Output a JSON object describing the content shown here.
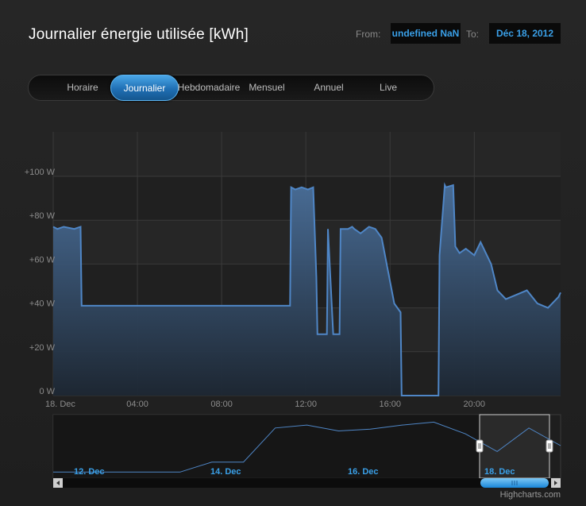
{
  "header": {
    "title": "Journalier énergie utilisée [kWh]",
    "from_label": "From:",
    "from_value": "undefined NaN",
    "to_label": "To:",
    "to_value": "Déc 18, 2012"
  },
  "tabs": [
    {
      "label": "Horaire",
      "active": false
    },
    {
      "label": "Journalier",
      "active": true
    },
    {
      "label": "Hebdomadaire",
      "active": false
    },
    {
      "label": "Mensuel",
      "active": false
    },
    {
      "label": "Annuel",
      "active": false
    },
    {
      "label": "Live",
      "active": false
    }
  ],
  "colors": {
    "accent": "#3aa0e8",
    "series_line": "#4f86c6",
    "background": "#232323"
  },
  "chart_data": {
    "type": "area",
    "y_ticks": [
      "0 W",
      "+20 W",
      "+40 W",
      "+60 W",
      "+80 W",
      "+100 W"
    ],
    "ylim": [
      -3,
      120
    ],
    "x_ticks": [
      "18. Dec",
      "04:00",
      "08:00",
      "12:00",
      "16:00",
      "20:00"
    ],
    "xlim": [
      0,
      24.1
    ],
    "grid": true,
    "series": [
      {
        "x": [
          0,
          0.2,
          0.5,
          1.0,
          1.3,
          1.35,
          11.25,
          11.3,
          11.5,
          11.8,
          12.1,
          12.35,
          12.5,
          12.55,
          13.0,
          13.05,
          13.3,
          13.6,
          13.65,
          14.0,
          14.2,
          14.3,
          14.6,
          15.0,
          15.3,
          15.6,
          16.2,
          16.5,
          16.55,
          17.0,
          18.3,
          18.35,
          18.6,
          18.65,
          19.0,
          19.1,
          19.3,
          19.6,
          20.0,
          20.3,
          20.8,
          21.1,
          21.5,
          22.0,
          22.5,
          23.0,
          23.5,
          24.0,
          24.1
        ],
        "y": [
          77,
          76,
          77,
          76,
          77,
          41,
          41,
          95,
          94,
          95,
          94,
          95,
          54,
          28,
          28,
          76,
          28,
          28,
          76,
          76,
          77,
          76,
          74,
          77,
          76,
          72,
          42,
          38,
          0,
          0,
          0,
          64,
          96,
          95,
          96,
          68,
          65,
          67,
          64,
          70,
          60,
          48,
          44,
          46,
          48,
          42,
          40,
          45,
          47
        ]
      }
    ]
  },
  "navigator": {
    "labels": [
      "12. Dec",
      "14. Dec",
      "16. Dec",
      "18. Dec"
    ],
    "series_y": [
      0.05,
      0.05,
      0.05,
      0.05,
      0.05,
      0.22,
      0.22,
      0.8,
      0.85,
      0.75,
      0.78,
      0.85,
      0.9,
      0.7,
      0.4,
      0.8,
      0.5
    ]
  },
  "credits": "Highcharts.com"
}
